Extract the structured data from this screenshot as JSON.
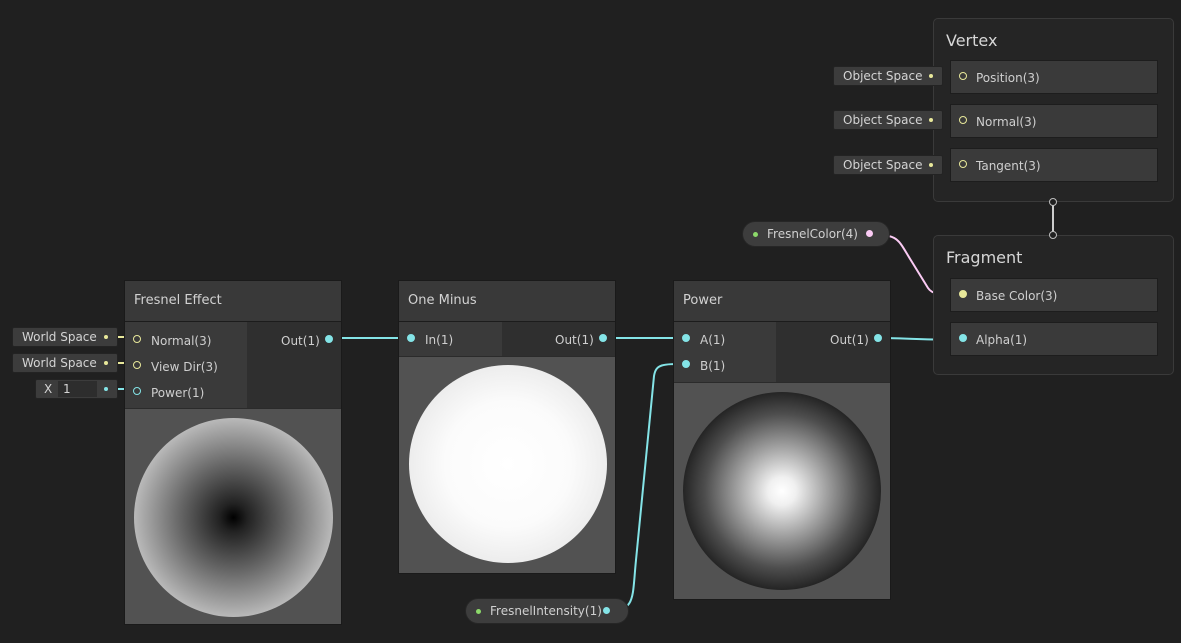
{
  "colors": {
    "vec3": "#e8e89a",
    "vec1": "#84e4e7",
    "vec4": "#fbcbf4",
    "property_dot": "#8cd96a",
    "edge_white": "#cccccc"
  },
  "fresnel": {
    "title": "Fresnel Effect",
    "inputs": [
      "Normal(3)",
      "View Dir(3)",
      "Power(1)"
    ],
    "output": "Out(1)",
    "fields": {
      "normal": "World Space",
      "view_dir": "World Space",
      "power_axis": "X",
      "power_value": "1"
    }
  },
  "one_minus": {
    "title": "One Minus",
    "input": "In(1)",
    "output": "Out(1)"
  },
  "power": {
    "title": "Power",
    "inputs": [
      "A(1)",
      "B(1)"
    ],
    "output": "Out(1)"
  },
  "vertex": {
    "title": "Vertex",
    "slots": [
      "Position(3)",
      "Normal(3)",
      "Tangent(3)"
    ],
    "fields": [
      "Object Space",
      "Object Space",
      "Object Space"
    ]
  },
  "fragment": {
    "title": "Fragment",
    "slots": [
      "Base Color(3)",
      "Alpha(1)"
    ]
  },
  "properties": {
    "color": "FresnelColor(4)",
    "intensity": "FresnelIntensity(1)"
  }
}
